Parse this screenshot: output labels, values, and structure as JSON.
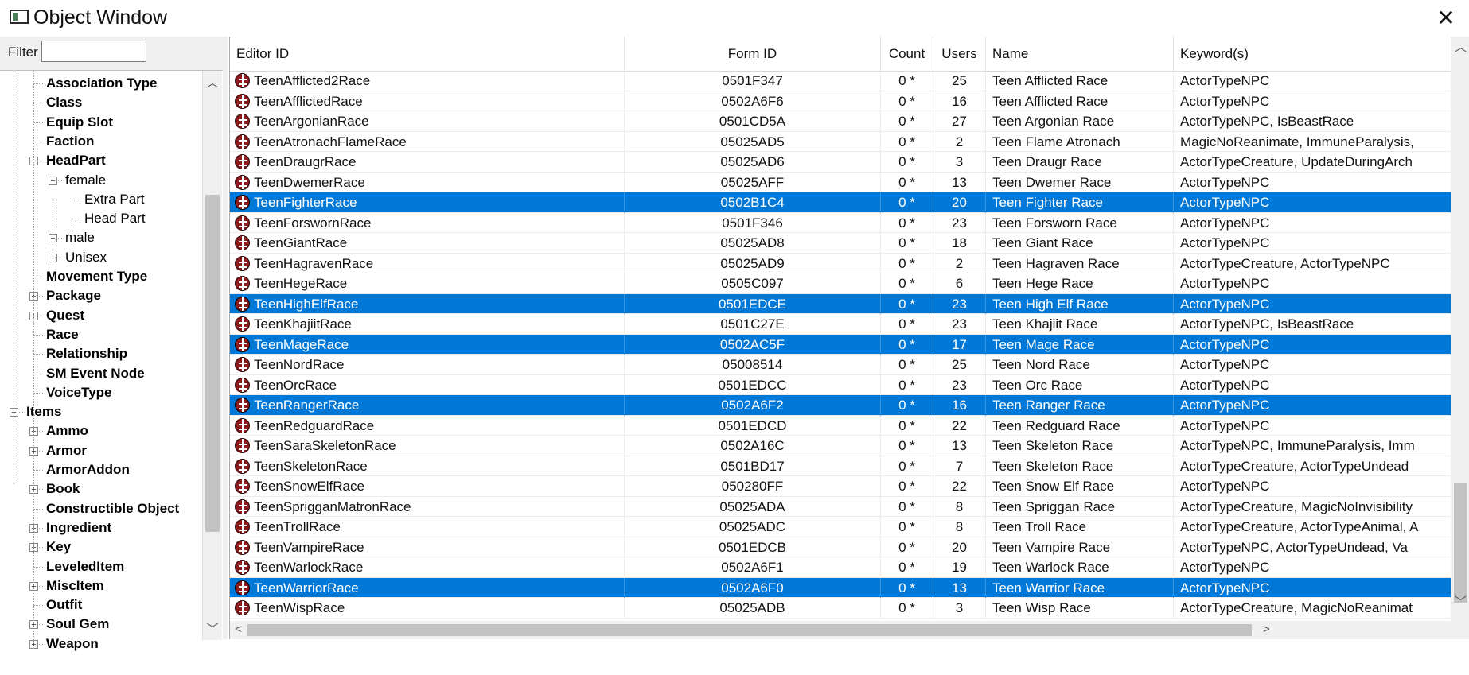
{
  "window": {
    "title": "Object Window"
  },
  "filter": {
    "label": "Filter",
    "value": ""
  },
  "tree": [
    {
      "label": "Association Type",
      "bold": true,
      "level": 2,
      "expander": ""
    },
    {
      "label": "Class",
      "bold": true,
      "level": 2,
      "expander": ""
    },
    {
      "label": "Equip Slot",
      "bold": true,
      "level": 2,
      "expander": ""
    },
    {
      "label": "Faction",
      "bold": true,
      "level": 2,
      "expander": ""
    },
    {
      "label": "HeadPart",
      "bold": true,
      "level": 2,
      "expander": "−"
    },
    {
      "label": "female",
      "bold": false,
      "level": 3,
      "expander": "−"
    },
    {
      "label": "Extra Part",
      "bold": false,
      "level": 4,
      "expander": ""
    },
    {
      "label": "Head Part",
      "bold": false,
      "level": 4,
      "expander": ""
    },
    {
      "label": "male",
      "bold": false,
      "level": 3,
      "expander": "+"
    },
    {
      "label": "Unisex",
      "bold": false,
      "level": 3,
      "expander": "+"
    },
    {
      "label": "Movement Type",
      "bold": true,
      "level": 2,
      "expander": ""
    },
    {
      "label": "Package",
      "bold": true,
      "level": 2,
      "expander": "+"
    },
    {
      "label": "Quest",
      "bold": true,
      "level": 2,
      "expander": "+"
    },
    {
      "label": "Race",
      "bold": true,
      "level": 2,
      "expander": ""
    },
    {
      "label": "Relationship",
      "bold": true,
      "level": 2,
      "expander": ""
    },
    {
      "label": "SM Event Node",
      "bold": true,
      "level": 2,
      "expander": ""
    },
    {
      "label": "VoiceType",
      "bold": true,
      "level": 2,
      "expander": ""
    },
    {
      "label": "Items",
      "bold": true,
      "level": 1,
      "expander": "−"
    },
    {
      "label": "Ammo",
      "bold": true,
      "level": 2,
      "expander": "+"
    },
    {
      "label": "Armor",
      "bold": true,
      "level": 2,
      "expander": "+"
    },
    {
      "label": "ArmorAddon",
      "bold": true,
      "level": 2,
      "expander": ""
    },
    {
      "label": "Book",
      "bold": true,
      "level": 2,
      "expander": "+"
    },
    {
      "label": "Constructible Object",
      "bold": true,
      "level": 2,
      "expander": ""
    },
    {
      "label": "Ingredient",
      "bold": true,
      "level": 2,
      "expander": "+"
    },
    {
      "label": "Key",
      "bold": true,
      "level": 2,
      "expander": "+"
    },
    {
      "label": "LeveledItem",
      "bold": true,
      "level": 2,
      "expander": ""
    },
    {
      "label": "MiscItem",
      "bold": true,
      "level": 2,
      "expander": "+"
    },
    {
      "label": "Outfit",
      "bold": true,
      "level": 2,
      "expander": ""
    },
    {
      "label": "Soul Gem",
      "bold": true,
      "level": 2,
      "expander": "+"
    },
    {
      "label": "Weapon",
      "bold": true,
      "level": 2,
      "expander": "+"
    }
  ],
  "columns": [
    "Editor ID",
    "Form ID",
    "Count",
    "Users",
    "Name",
    "Keyword(s)"
  ],
  "rows": [
    {
      "editor_id": "TeenAfflicted2Race",
      "form_id": "0501F347",
      "count": "0 *",
      "users": "25",
      "name": "Teen Afflicted Race",
      "keywords": "ActorTypeNPC",
      "selected": false
    },
    {
      "editor_id": "TeenAfflictedRace",
      "form_id": "0502A6F6",
      "count": "0 *",
      "users": "16",
      "name": "Teen Afflicted Race",
      "keywords": "ActorTypeNPC",
      "selected": false
    },
    {
      "editor_id": "TeenArgonianRace",
      "form_id": "0501CD5A",
      "count": "0 *",
      "users": "27",
      "name": "Teen Argonian Race",
      "keywords": "ActorTypeNPC, IsBeastRace",
      "selected": false
    },
    {
      "editor_id": "TeenAtronachFlameRace",
      "form_id": "05025AD5",
      "count": "0 *",
      "users": "2",
      "name": "Teen Flame Atronach",
      "keywords": "MagicNoReanimate, ImmuneParalysis,",
      "selected": false
    },
    {
      "editor_id": "TeenDraugrRace",
      "form_id": "05025AD6",
      "count": "0 *",
      "users": "3",
      "name": "Teen Draugr Race",
      "keywords": "ActorTypeCreature, UpdateDuringArch",
      "selected": false
    },
    {
      "editor_id": "TeenDwemerRace",
      "form_id": "05025AFF",
      "count": "0 *",
      "users": "13",
      "name": "Teen Dwemer Race",
      "keywords": "ActorTypeNPC",
      "selected": false
    },
    {
      "editor_id": "TeenFighterRace",
      "form_id": "0502B1C4",
      "count": "0 *",
      "users": "20",
      "name": "Teen Fighter Race",
      "keywords": "ActorTypeNPC",
      "selected": true
    },
    {
      "editor_id": "TeenForswornRace",
      "form_id": "0501F346",
      "count": "0 *",
      "users": "23",
      "name": "Teen Forsworn Race",
      "keywords": "ActorTypeNPC",
      "selected": false
    },
    {
      "editor_id": "TeenGiantRace",
      "form_id": "05025AD8",
      "count": "0 *",
      "users": "18",
      "name": "Teen Giant Race",
      "keywords": "ActorTypeNPC",
      "selected": false
    },
    {
      "editor_id": "TeenHagravenRace",
      "form_id": "05025AD9",
      "count": "0 *",
      "users": "2",
      "name": "Teen Hagraven Race",
      "keywords": "ActorTypeCreature, ActorTypeNPC",
      "selected": false
    },
    {
      "editor_id": "TeenHegeRace",
      "form_id": "0505C097",
      "count": "0 *",
      "users": "6",
      "name": "Teen Hege Race",
      "keywords": "ActorTypeNPC",
      "selected": false
    },
    {
      "editor_id": "TeenHighElfRace",
      "form_id": "0501EDCE",
      "count": "0 *",
      "users": "23",
      "name": "Teen High Elf Race",
      "keywords": "ActorTypeNPC",
      "selected": true
    },
    {
      "editor_id": "TeenKhajiitRace",
      "form_id": "0501C27E",
      "count": "0 *",
      "users": "23",
      "name": "Teen Khajiit Race",
      "keywords": "ActorTypeNPC, IsBeastRace",
      "selected": false
    },
    {
      "editor_id": "TeenMageRace",
      "form_id": "0502AC5F",
      "count": "0 *",
      "users": "17",
      "name": "Teen Mage Race",
      "keywords": "ActorTypeNPC",
      "selected": true
    },
    {
      "editor_id": "TeenNordRace",
      "form_id": "05008514",
      "count": "0 *",
      "users": "25",
      "name": "Teen Nord Race",
      "keywords": "ActorTypeNPC",
      "selected": false
    },
    {
      "editor_id": "TeenOrcRace",
      "form_id": "0501EDCC",
      "count": "0 *",
      "users": "23",
      "name": "Teen Orc Race",
      "keywords": "ActorTypeNPC",
      "selected": false
    },
    {
      "editor_id": "TeenRangerRace",
      "form_id": "0502A6F2",
      "count": "0 *",
      "users": "16",
      "name": "Teen Ranger Race",
      "keywords": "ActorTypeNPC",
      "selected": true
    },
    {
      "editor_id": "TeenRedguardRace",
      "form_id": "0501EDCD",
      "count": "0 *",
      "users": "22",
      "name": "Teen Redguard Race",
      "keywords": "ActorTypeNPC",
      "selected": false
    },
    {
      "editor_id": "TeenSaraSkeletonRace",
      "form_id": "0502A16C",
      "count": "0 *",
      "users": "13",
      "name": "Teen Skeleton Race",
      "keywords": "ActorTypeNPC, ImmuneParalysis, Imm",
      "selected": false
    },
    {
      "editor_id": "TeenSkeletonRace",
      "form_id": "0501BD17",
      "count": "0 *",
      "users": "7",
      "name": "Teen Skeleton Race",
      "keywords": "ActorTypeCreature, ActorTypeUndead",
      "selected": false
    },
    {
      "editor_id": "TeenSnowElfRace",
      "form_id": "050280FF",
      "count": "0 *",
      "users": "22",
      "name": "Teen Snow Elf Race",
      "keywords": "ActorTypeNPC",
      "selected": false
    },
    {
      "editor_id": "TeenSprigganMatronRace",
      "form_id": "05025ADA",
      "count": "0 *",
      "users": "8",
      "name": "Teen Spriggan Race",
      "keywords": "ActorTypeCreature, MagicNoInvisibility",
      "selected": false
    },
    {
      "editor_id": "TeenTrollRace",
      "form_id": "05025ADC",
      "count": "0 *",
      "users": "8",
      "name": "Teen Troll Race",
      "keywords": "ActorTypeCreature, ActorTypeAnimal, A",
      "selected": false
    },
    {
      "editor_id": "TeenVampireRace",
      "form_id": "0501EDCB",
      "count": "0 *",
      "users": "20",
      "name": "Teen Vampire Race",
      "keywords": "ActorTypeNPC, ActorTypeUndead, Va",
      "selected": false
    },
    {
      "editor_id": "TeenWarlockRace",
      "form_id": "0502A6F1",
      "count": "0 *",
      "users": "19",
      "name": "Teen Warlock Race",
      "keywords": "ActorTypeNPC",
      "selected": false
    },
    {
      "editor_id": "TeenWarriorRace",
      "form_id": "0502A6F0",
      "count": "0 *",
      "users": "13",
      "name": "Teen Warrior Race",
      "keywords": "ActorTypeNPC",
      "selected": true
    },
    {
      "editor_id": "TeenWispRace",
      "form_id": "05025ADB",
      "count": "0 *",
      "users": "3",
      "name": "Teen Wisp Race",
      "keywords": "ActorTypeCreature, MagicNoReanimat",
      "selected": false
    }
  ],
  "colors": {
    "selection": "#0078d7",
    "race_icon": "#8b1a1a"
  },
  "icons": {
    "row_icon": "race-mask-icon",
    "close": "close-icon"
  }
}
